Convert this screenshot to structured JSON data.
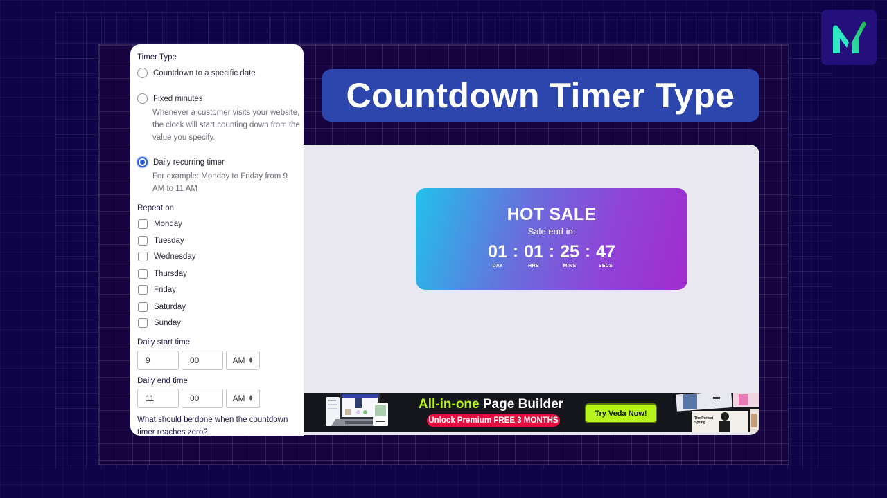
{
  "branding": {
    "logo_letter": "M",
    "logo_colors": {
      "bg": "#23107a",
      "letter": "#2ee8c4",
      "tick": "#2fbf5c"
    }
  },
  "title_banner": {
    "text": "Countdown Timer Type",
    "bg": "#2c46ad"
  },
  "settings": {
    "timer_type_label": "Timer Type",
    "options": [
      {
        "label": "Countdown to a specific date",
        "selected": false,
        "help": ""
      },
      {
        "label": "Fixed minutes",
        "selected": false,
        "help": "Whenever a customer visits your website, the clock will start counting down from the value you specify."
      },
      {
        "label": "Daily recurring timer",
        "selected": true,
        "help": "For example: Monday to Friday from 9 AM to 11 AM"
      }
    ],
    "repeat_on_label": "Repeat on",
    "days": [
      {
        "label": "Monday",
        "checked": false
      },
      {
        "label": "Tuesday",
        "checked": false
      },
      {
        "label": "Wednesday",
        "checked": false
      },
      {
        "label": "Thursday",
        "checked": false
      },
      {
        "label": "Friday",
        "checked": false
      },
      {
        "label": "Saturday",
        "checked": false
      },
      {
        "label": "Sunday",
        "checked": false
      }
    ],
    "start_time": {
      "label": "Daily start time",
      "hour": "9",
      "minute": "00",
      "period": "AM"
    },
    "end_time": {
      "label": "Daily end time",
      "hour": "11",
      "minute": "00",
      "period": "AM"
    },
    "zero_question": "What should be done when the countdown timer reaches zero?"
  },
  "preview": {
    "timer": {
      "title": "HOT SALE",
      "subtitle": "Sale end in:",
      "units": [
        {
          "value": "01",
          "label": "DAY"
        },
        {
          "value": "01",
          "label": "HRS"
        },
        {
          "value": "25",
          "label": "MINS"
        },
        {
          "value": "47",
          "label": "SECS"
        }
      ],
      "separator": ":"
    },
    "ad": {
      "headline_accent": "All-in-one",
      "headline_rest": " Page Builder",
      "pill": "Unlock Premium FREE 3 MONTHS",
      "cta": "Try Veda Now!",
      "photo_caption": "The Perfect Spring",
      "colors": {
        "accent": "#b7f41d",
        "pill": "#e3103f",
        "bg": "#15171c"
      }
    }
  }
}
